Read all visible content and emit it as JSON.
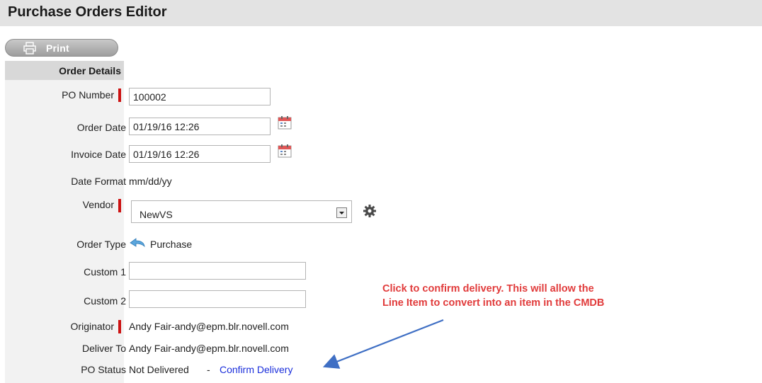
{
  "header": {
    "title": "Purchase Orders Editor"
  },
  "toolbar": {
    "print_label": "Print"
  },
  "section": {
    "title": "Order Details"
  },
  "fields": {
    "po_number": {
      "label": "PO Number",
      "value": "100002",
      "required": true
    },
    "order_date": {
      "label": "Order Date",
      "value": "01/19/16 12:26"
    },
    "invoice_date": {
      "label": "Invoice Date",
      "value": "01/19/16 12:26"
    },
    "date_format": {
      "label": "Date Format",
      "value": "mm/dd/yy"
    },
    "vendor": {
      "label": "Vendor",
      "value": "NewVS",
      "required": true
    },
    "order_type": {
      "label": "Order Type",
      "value": "Purchase"
    },
    "custom1": {
      "label": "Custom 1",
      "value": ""
    },
    "custom2": {
      "label": "Custom 2",
      "value": ""
    },
    "originator": {
      "label": "Originator",
      "value": "Andy Fair-andy@epm.blr.novell.com",
      "required": true
    },
    "deliver_to": {
      "label": "Deliver To",
      "value": "Andy Fair-andy@epm.blr.novell.com"
    },
    "po_status": {
      "label": "PO Status",
      "value": "Not Delivered",
      "separator": "-",
      "link": "Confirm Delivery"
    }
  },
  "annotation": {
    "line1": "Click to confirm delivery. This will allow the",
    "line2": "Line Item to convert into an item in the CMDB",
    "color": "#e13b3b",
    "arrow_color": "#3f6fc4"
  },
  "colors": {
    "required_marker": "#cc1212",
    "link": "#1a2edb"
  }
}
